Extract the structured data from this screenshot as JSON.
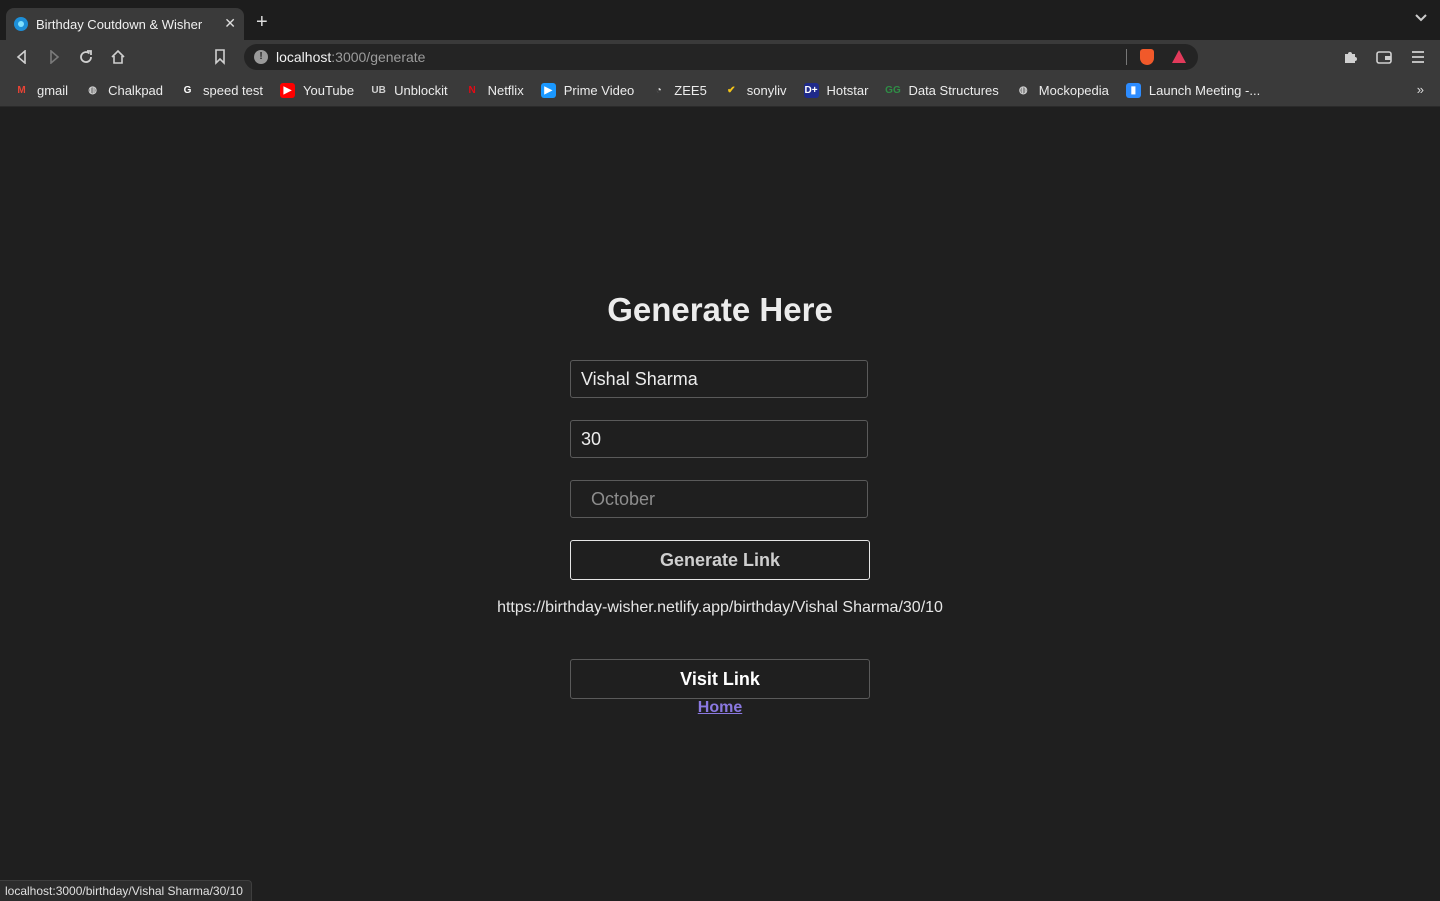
{
  "browser": {
    "tab_title": "Birthday Coutdown & Wisher",
    "tab_close": "✕",
    "new_tab": "+",
    "url_host": "localhost",
    "url_path": ":3000/generate",
    "bookmarks": [
      {
        "label": "gmail",
        "icon": "gmail-icon",
        "glyph": "M",
        "color": "#ea4335",
        "bg": "transparent"
      },
      {
        "label": "Chalkpad",
        "icon": "globe-icon",
        "glyph": "◍",
        "color": "#cfcfcf",
        "bg": "transparent"
      },
      {
        "label": "speed test",
        "icon": "google-icon",
        "glyph": "G",
        "color": "#ffffff",
        "bg": "transparent"
      },
      {
        "label": "YouTube",
        "icon": "youtube-icon",
        "glyph": "▶",
        "color": "#ffffff",
        "bg": "#ff0000"
      },
      {
        "label": "Unblockit",
        "icon": "unblockit-icon",
        "glyph": "UB",
        "color": "#cfcfcf",
        "bg": "transparent"
      },
      {
        "label": "Netflix",
        "icon": "netflix-icon",
        "glyph": "N",
        "color": "#e50914",
        "bg": "transparent"
      },
      {
        "label": "Prime Video",
        "icon": "prime-video-icon",
        "glyph": "▶",
        "color": "#ffffff",
        "bg": "#1a98ff"
      },
      {
        "label": "ZEE5",
        "icon": "zee5-icon",
        "glyph": "◔",
        "color": "#dddddd",
        "bg": "transparent"
      },
      {
        "label": "sonyliv",
        "icon": "sonyliv-icon",
        "glyph": "✔",
        "color": "#f5c518",
        "bg": "transparent"
      },
      {
        "label": "Hotstar",
        "icon": "hotstar-icon",
        "glyph": "D+",
        "color": "#ffffff",
        "bg": "#1f2a8a"
      },
      {
        "label": "Data Structures",
        "icon": "geeksforgeeks-icon",
        "glyph": "GG",
        "color": "#2f8d46",
        "bg": "transparent"
      },
      {
        "label": "Mockopedia",
        "icon": "globe-icon",
        "glyph": "◍",
        "color": "#cfcfcf",
        "bg": "transparent"
      },
      {
        "label": "Launch Meeting -...",
        "icon": "zoom-icon",
        "glyph": "▮",
        "color": "#ffffff",
        "bg": "#2d8cff"
      }
    ],
    "status_url": "localhost:3000/birthday/Vishal Sharma/30/10"
  },
  "page": {
    "heading": "Generate Here",
    "name_value": "Vishal Sharma",
    "day_value": "30",
    "month_placeholder": "October",
    "generate_label": "Generate Link",
    "generated_link": "https://birthday-wisher.netlify.app/birthday/Vishal Sharma/30/10",
    "visit_label": "Visit Link",
    "home_label": "Home"
  }
}
